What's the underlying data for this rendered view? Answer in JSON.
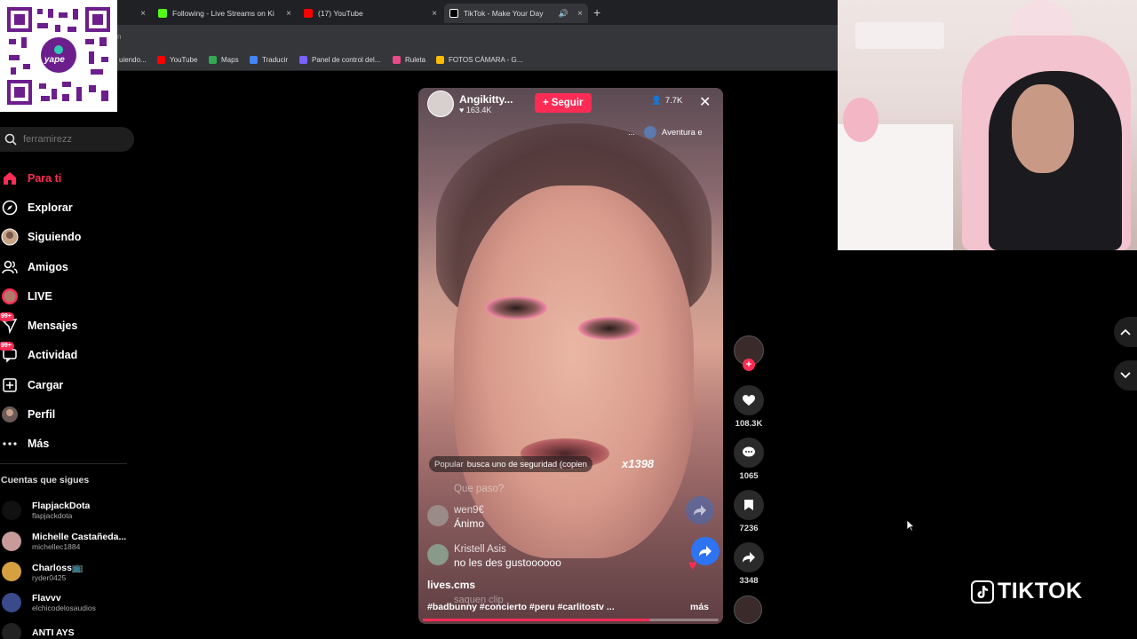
{
  "browser": {
    "tabs": [
      {
        "title": "Following - Live Streams on Ki",
        "icon": "kick-icon",
        "color": "#53fc18"
      },
      {
        "title": "(17) YouTube",
        "icon": "youtube-icon",
        "color": "#ff0000"
      },
      {
        "title": "TikTok - Make Your Day",
        "icon": "tiktok-icon",
        "color": "#ffffff",
        "active": true
      }
    ],
    "partial_tab_close": "×",
    "address_text": "n",
    "bookmarks": [
      {
        "label": "uiendo...",
        "color": "#9147ff"
      },
      {
        "label": "YouTube",
        "color": "#ff0000"
      },
      {
        "label": "Maps",
        "color": "#34a853"
      },
      {
        "label": "Traducir",
        "color": "#4285f4"
      },
      {
        "label": "Panel de control del...",
        "color": "#7b61ff"
      },
      {
        "label": "Ruleta",
        "color": "#e94a8a"
      },
      {
        "label": "FOTOS CÁMARA - G...",
        "color": "#fbbc04"
      }
    ]
  },
  "qr": {
    "brand": "yape"
  },
  "sidebar": {
    "search_placeholder": "ferramirezz",
    "nav": [
      {
        "label": "Para ti",
        "icon": "home-icon",
        "active": true
      },
      {
        "label": "Explorar",
        "icon": "compass-icon"
      },
      {
        "label": "Siguiendo",
        "icon": "following-icon"
      },
      {
        "label": "Amigos",
        "icon": "friends-icon"
      },
      {
        "label": "LIVE",
        "icon": "live-icon"
      },
      {
        "label": "Mensajes",
        "icon": "messages-icon",
        "badge": "99+"
      },
      {
        "label": "Actividad",
        "icon": "activity-icon",
        "badge": "99+"
      },
      {
        "label": "Cargar",
        "icon": "upload-icon"
      },
      {
        "label": "Perfil",
        "icon": "profile-icon"
      },
      {
        "label": "Más",
        "icon": "more-icon"
      }
    ],
    "accounts_heading": "Cuentas que sigues",
    "accounts": [
      {
        "name": "FlapjackDota",
        "handle": "flapjackdota",
        "color": "#111111"
      },
      {
        "name": "Michelle Castañeda...",
        "handle": "michellec1884",
        "color": "#c89a9a"
      },
      {
        "name": "Charloss📺",
        "handle": "ryder0425",
        "color": "#d6a040"
      },
      {
        "name": "Flavvv",
        "handle": "elchicodelosaudios",
        "color": "#3a4a8a"
      },
      {
        "name": "ANTI AYS",
        "handle": "",
        "color": "#222222"
      }
    ]
  },
  "live": {
    "host_name": "Angikitty...",
    "host_likes": "163.4K",
    "follow_label": "Seguir",
    "viewers": "7.7K",
    "topic_prefix": "...",
    "topic": "Aventura e",
    "pinned_label": "Popular",
    "pinned_text": "busca uno de seguridad (copien",
    "gift_count": "x1398",
    "ghost_comment_top": "Que paso?",
    "comments": [
      {
        "user": "wen9€",
        "text": "Ánimo"
      },
      {
        "user": "Kristell Asis",
        "text": "no les des gustoooooo"
      }
    ],
    "ghost_comment_bottom": "saquen clip",
    "caption_user": "lives.cms",
    "caption_tags": "#badbunny #concierto #peru #carlitostv ...",
    "caption_more": "más",
    "progress": 0.77
  },
  "rail": {
    "likes": "108.3K",
    "comments": "1065",
    "saves": "7236",
    "shares": "3348"
  },
  "brand": {
    "name": "TIKTOK"
  },
  "colors": {
    "accent": "#fe2c55",
    "share": "#2e74f2"
  }
}
